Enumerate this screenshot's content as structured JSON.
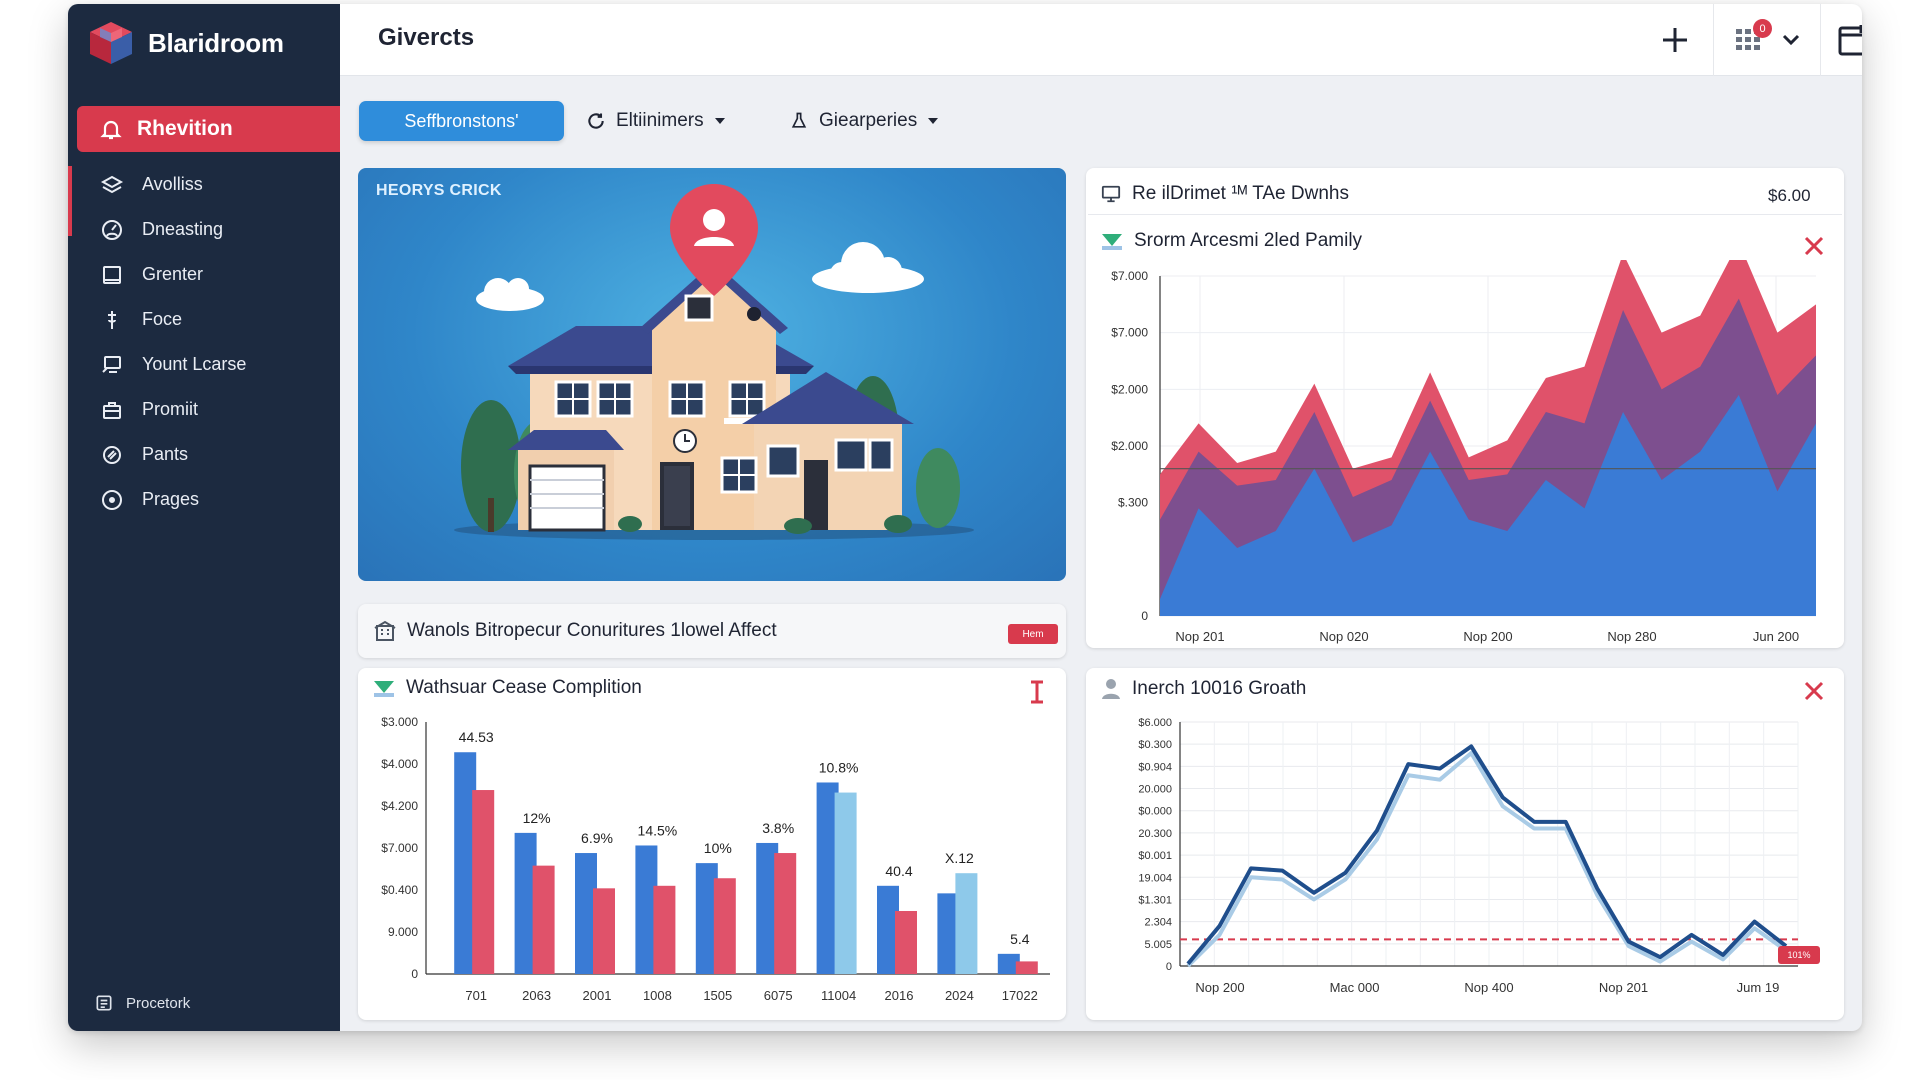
{
  "app": {
    "brand": "Blaridroom"
  },
  "header": {
    "title": "Givercts",
    "notification_count": "0"
  },
  "sidebar": {
    "active": {
      "label": "Rhevition",
      "icon": "bell-icon"
    },
    "items": [
      {
        "label": "Avolliss",
        "icon": "layers-icon"
      },
      {
        "label": "Dneasting",
        "icon": "gauge-icon"
      },
      {
        "label": "Grenter",
        "icon": "square-icon"
      },
      {
        "label": "Foce",
        "icon": "pin-icon"
      },
      {
        "label": "Yount Lcarse",
        "icon": "monitor-icon"
      },
      {
        "label": "Promiit",
        "icon": "briefcase-icon"
      },
      {
        "label": "Pants",
        "icon": "tag-icon"
      },
      {
        "label": "Prages",
        "icon": "circle-icon"
      }
    ],
    "footer": {
      "label": "Procetork",
      "icon": "list-icon"
    }
  },
  "toolbar": {
    "primary": "Seffbronstons'",
    "dropdown1": "Eltiinimers",
    "dropdown2": "Giearperies"
  },
  "hero": {
    "label": "HEORYS CRICK"
  },
  "panel_area": {
    "header_title": "Re ilDrimet ¹ᴹ TAe Dwnhs",
    "header_value": "$6.00",
    "card_title": "Srorm Arcesmi 2led Pamily"
  },
  "mid_banner": {
    "title": "Wanols Bitropecur Conuritures 1lowel Affect",
    "tag": "Hem"
  },
  "panel_bar": {
    "card_title": "Wathsuar Cease Complition"
  },
  "panel_line": {
    "card_title": "Inerch 10016 Groath",
    "tag": "101%"
  },
  "colors": {
    "sidebar": "#1c2a40",
    "accent_red": "#d83a4d",
    "accent_blue": "#2f8ddb",
    "chart_blue": "#3a7bd5",
    "chart_red": "#e0526a",
    "chart_purple": "#6b4f95",
    "line_navy": "#1f4e8c"
  },
  "chart_data": [
    {
      "type": "area",
      "title": "Srorm Arcesmi 2led Pamily",
      "y_tick_labels": [
        "$7.000",
        "$7.000",
        "$2.000",
        "$2.000",
        "$.300",
        "",
        "0"
      ],
      "x_tick_labels": [
        "Nop 201",
        "Nop 020",
        "Nop 200",
        "Nop 280",
        "Jun 200"
      ],
      "ylim": [
        0,
        6
      ],
      "reference_line": 2.6,
      "series": [
        {
          "values": [
            0.3,
            1.9,
            1.2,
            1.5,
            2.6,
            1.3,
            1.6,
            2.9,
            1.7,
            1.5,
            2.4,
            1.9,
            3.6,
            2.4,
            2.9,
            3.9,
            2.2,
            3.4
          ]
        },
        {
          "values": [
            1.7,
            2.9,
            2.3,
            2.4,
            3.6,
            2.1,
            2.4,
            3.8,
            2.4,
            2.5,
            3.6,
            3.4,
            5.4,
            4.0,
            4.4,
            5.6,
            3.9,
            4.6
          ]
        },
        {
          "values": [
            2.5,
            3.4,
            2.7,
            2.9,
            4.1,
            2.6,
            2.8,
            4.3,
            2.8,
            3.1,
            4.2,
            4.4,
            6.4,
            5.0,
            5.3,
            6.6,
            5.0,
            5.5
          ]
        }
      ],
      "grid": true
    },
    {
      "type": "bar",
      "title": "Wathsuar Cease Complition",
      "categories": [
        "701",
        "2063",
        "2001",
        "1008",
        "1505",
        "6075",
        "11004",
        "2016",
        "2024",
        "17022"
      ],
      "y_tick_labels": [
        "$3.000",
        "$4.000",
        "$4.200",
        "$7.000",
        "$0.400",
        "9.000",
        "0"
      ],
      "ylim": [
        0,
        100
      ],
      "series": [
        {
          "values": [
            88,
            56,
            48,
            51,
            44,
            52,
            76,
            35,
            32,
            8
          ]
        },
        {
          "values": [
            73,
            43,
            34,
            35,
            38,
            48,
            72,
            25,
            40,
            5
          ]
        }
      ],
      "data_labels": [
        "44.53",
        "12%",
        "6.9%",
        "14.5%",
        "10%",
        "3.8%",
        "10.8%",
        "40.4",
        "X.12",
        "5.4"
      ],
      "grid": false
    },
    {
      "type": "line",
      "title": "Inerch 10016 Groath",
      "x_tick_labels": [
        "Nop 200",
        "Mac 000",
        "Nop 400",
        "Nop 201",
        "Jum 19"
      ],
      "y_tick_labels": [
        "$6.000",
        "$0.300",
        "$0.904",
        "20.000",
        "$0.000",
        "20.300",
        "$0.001",
        "19.004",
        "$1.301",
        "2.304",
        "5.005",
        "0"
      ],
      "ylim": [
        0,
        11
      ],
      "reference_line": 1.2,
      "series": [
        {
          "values": [
            0.1,
            1.8,
            4.4,
            4.3,
            3.3,
            4.2,
            6.1,
            9.1,
            8.9,
            9.9,
            7.6,
            6.5,
            6.5,
            3.5,
            1.1,
            0.4,
            1.4,
            0.5,
            2.0,
            0.9
          ]
        },
        {
          "values": [
            0.0,
            1.4,
            4.0,
            3.9,
            3.0,
            3.9,
            5.7,
            8.6,
            8.4,
            9.6,
            7.2,
            6.2,
            6.2,
            3.2,
            0.9,
            0.2,
            1.1,
            0.3,
            1.7,
            0.7
          ]
        }
      ],
      "grid": true
    }
  ]
}
